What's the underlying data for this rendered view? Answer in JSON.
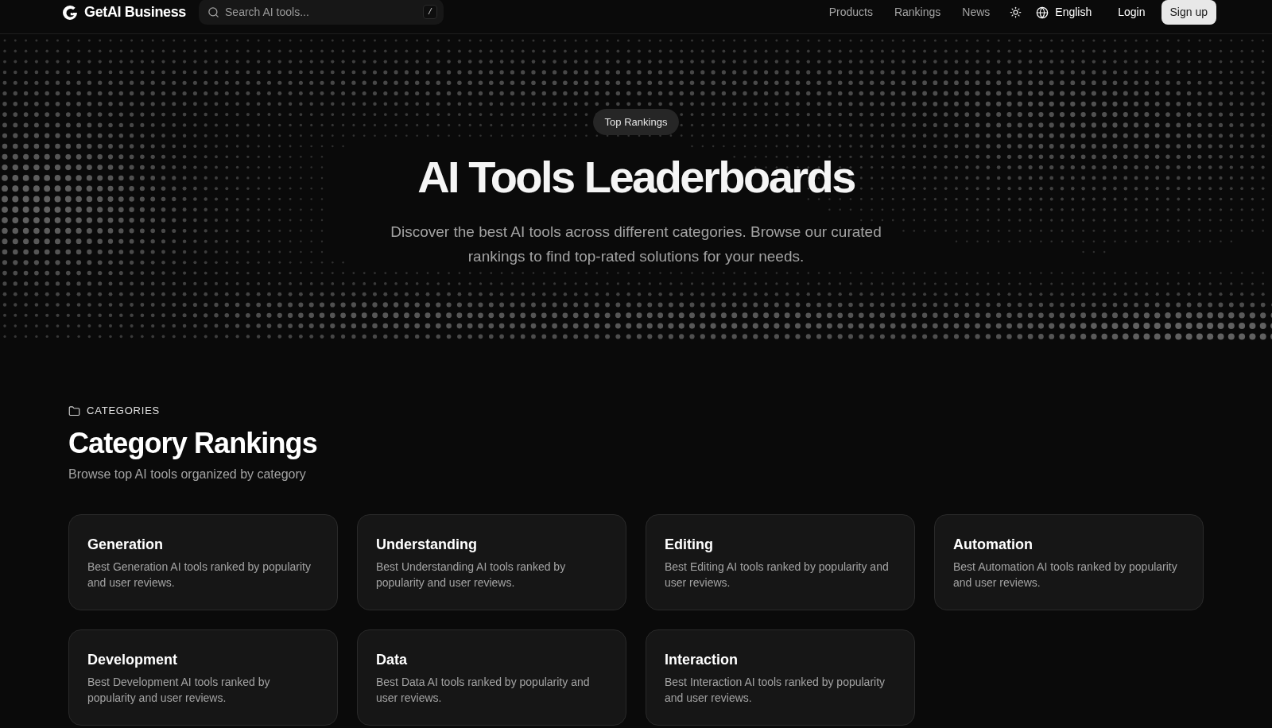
{
  "navbar": {
    "brand": "GetAI Business",
    "search": {
      "placeholder": "Search AI tools...",
      "shortcut": "/"
    },
    "links": [
      "Products",
      "Rankings",
      "News"
    ],
    "language": "English",
    "login": "Login",
    "signup": "Sign up"
  },
  "hero": {
    "badge": "Top Rankings",
    "title": "AI Tools Leaderboards",
    "subtitle": "Discover the best AI tools across different categories. Browse our curated rankings to find top-rated solutions for your needs."
  },
  "categories_section": {
    "eyebrow": "CATEGORIES",
    "title": "Category Rankings",
    "subtitle": "Browse top AI tools organized by category",
    "cards": [
      {
        "title": "Generation",
        "description": "Best Generation AI tools ranked by popularity and user reviews."
      },
      {
        "title": "Understanding",
        "description": "Best Understanding AI tools ranked by popularity and user reviews."
      },
      {
        "title": "Editing",
        "description": "Best Editing AI tools ranked by popularity and user reviews."
      },
      {
        "title": "Automation",
        "description": "Best Automation AI tools ranked by popularity and user reviews."
      },
      {
        "title": "Development",
        "description": "Best Development AI tools ranked by popularity and user reviews."
      },
      {
        "title": "Data",
        "description": "Best Data AI tools ranked by popularity and user reviews."
      },
      {
        "title": "Interaction",
        "description": "Best Interaction AI tools ranked by popularity and user reviews."
      }
    ]
  }
}
